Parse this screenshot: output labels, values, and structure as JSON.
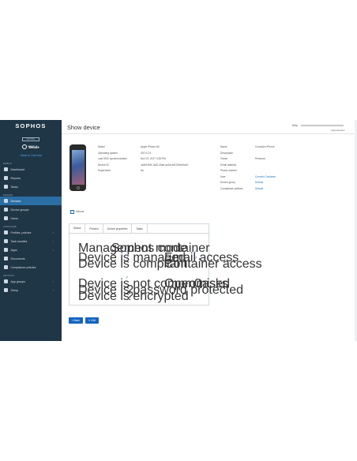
{
  "brand": {
    "name": "SOPHOS",
    "tagline": "CENTRAL",
    "subtitle": "Admin"
  },
  "sidebar": {
    "module": "Mobile",
    "back": "Back to Overview",
    "sections": [
      {
        "title": "MOBILE",
        "items": [
          {
            "label": "Dashboard",
            "icon": "dashboard-icon"
          },
          {
            "label": "Reports",
            "icon": "reports-icon"
          },
          {
            "label": "Tasks",
            "icon": "tasks-icon"
          }
        ]
      },
      {
        "title": "MANAGE",
        "items": [
          {
            "label": "Devices",
            "icon": "device-icon",
            "active": true
          },
          {
            "label": "Device groups",
            "icon": "device-group-icon"
          },
          {
            "label": "Users",
            "icon": "user-icon"
          }
        ]
      },
      {
        "title": "CONFIGURE",
        "items": [
          {
            "label": "Profiles, policies",
            "icon": "shield-icon",
            "chevron": true
          },
          {
            "label": "Task bundles",
            "icon": "bundle-icon",
            "chevron": true
          },
          {
            "label": "Apps",
            "icon": "apps-icon",
            "chevron": true
          },
          {
            "label": "Documents",
            "icon": "document-icon"
          },
          {
            "label": "Compliance policies",
            "icon": "compliance-icon"
          }
        ]
      },
      {
        "title": "SETTINGS",
        "items": [
          {
            "label": "App groups",
            "icon": "grid-icon",
            "chevron": true
          },
          {
            "label": "Setup",
            "icon": "gear-icon",
            "chevron": true
          }
        ]
      }
    ]
  },
  "header": {
    "title": "Show device",
    "help": "Help",
    "role": "Administrator"
  },
  "device": {
    "left": [
      {
        "k": "Model",
        "v": "Apple iPhone 6S"
      },
      {
        "k": "Operating system",
        "v": "iOS 9.2.5"
      },
      {
        "k": "Last SMC synchronization",
        "v": "Nov 03, 2017 3:28 PM"
      },
      {
        "k": "Device ID",
        "v": "4c6b1908-1a32-40ab-ac2a-a6123b6c0ae2"
      },
      {
        "k": "Supervised",
        "v": "No"
      }
    ],
    "right": [
      {
        "k": "Name",
        "v": "Corrado's iPhone",
        "link": false
      },
      {
        "k": "Description",
        "v": "",
        "link": false
      },
      {
        "k": "Owner",
        "v": "Personal",
        "link": false
      },
      {
        "k": "Email address",
        "v": "",
        "link": false
      },
      {
        "k": "Phone number",
        "v": "",
        "link": false
      },
      {
        "k": "User",
        "v": "Corrado Container",
        "link": true
      },
      {
        "k": "Device group",
        "v": "Default",
        "link": true
      },
      {
        "k": "Compliance policies",
        "v": "Default",
        "link": true
      }
    ]
  },
  "actions_label": "Actions",
  "tabs": [
    "Status",
    "Policies",
    "Device properties",
    "Tasks"
  ],
  "status": {
    "management_mode_label": "Management mode",
    "management_mode_value": "Sophos container",
    "device_managed": "Device is managed",
    "device_compliant": "Device is compliant",
    "email_access": "Email access",
    "container_access": "Container access",
    "not_compromised": "Device is not compromised",
    "password_protected": "Device is password protected",
    "encrypted": "Device is encrypted",
    "open_tasks_label": "Open tasks",
    "open_tasks_value": "0",
    "unknown_marker": "?"
  },
  "buttons": {
    "back": "Back",
    "edit": "Edit"
  }
}
